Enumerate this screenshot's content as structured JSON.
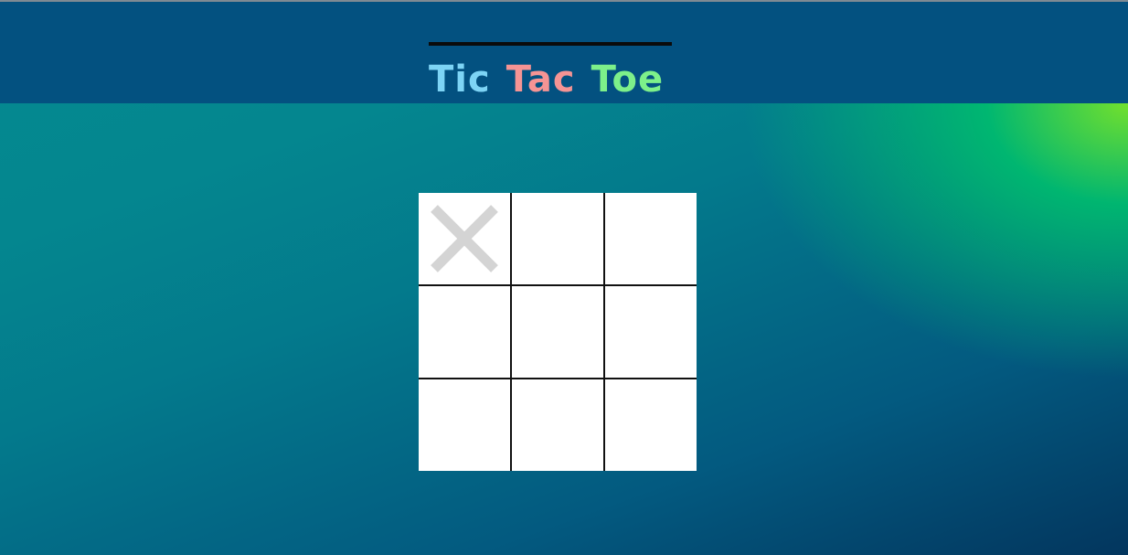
{
  "title": {
    "words": [
      {
        "text": "Tic",
        "color": "#7dd4f5"
      },
      {
        "text": "Tac",
        "color": "#f59494"
      },
      {
        "text": "Toe",
        "color": "#7df08a"
      }
    ]
  },
  "board": {
    "cells": [
      "X",
      "",
      "",
      "",
      "",
      "",
      "",
      "",
      ""
    ],
    "x_mark_color": "#d4d4d4"
  },
  "colors": {
    "header_bg": "#035180",
    "grid_line": "#111111",
    "cell_bg": "#ffffff"
  }
}
